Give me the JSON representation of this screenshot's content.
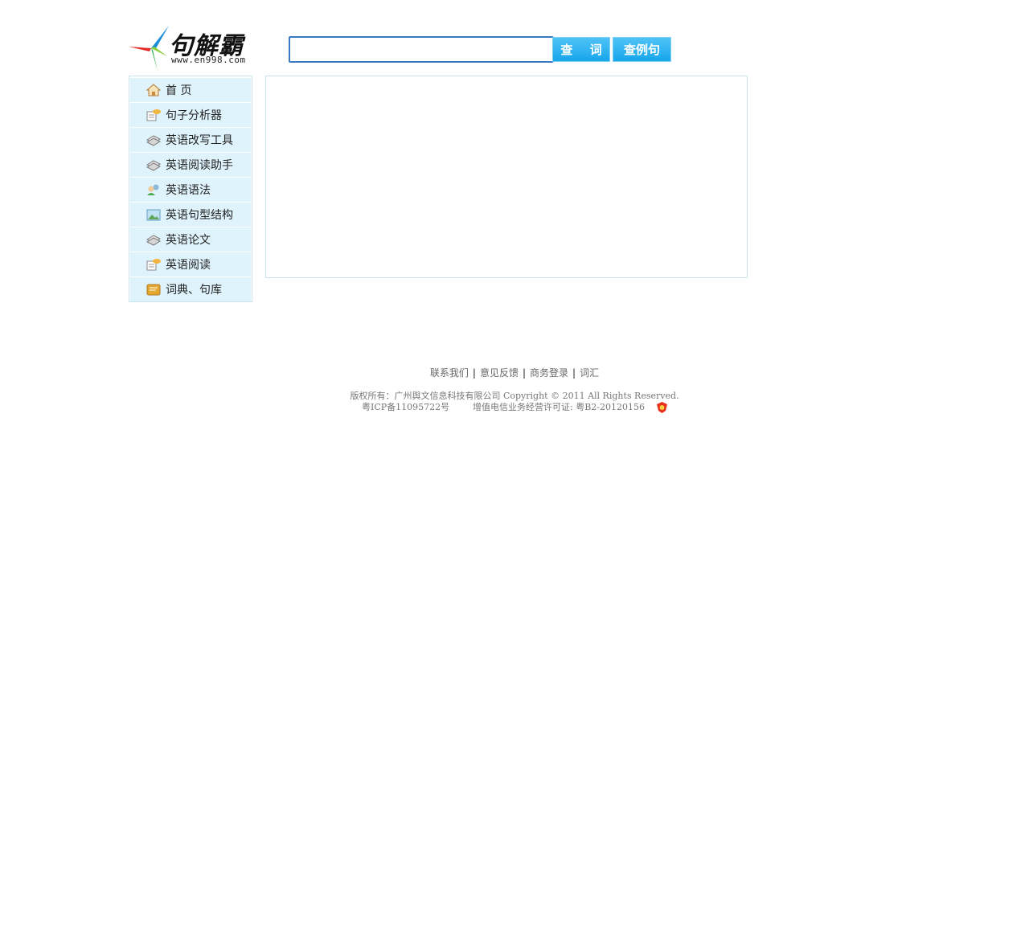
{
  "header": {
    "logo_title": "句解霸",
    "logo_url": "www.en998.com",
    "search_placeholder": "",
    "search_value": "",
    "btn_word": "查 词",
    "btn_sentence": "查例句"
  },
  "sidebar": {
    "items": [
      {
        "label": "首 页",
        "icon": "home-icon"
      },
      {
        "label": "句子分析器",
        "icon": "notepad-icon"
      },
      {
        "label": "英语改写工具",
        "icon": "books-icon"
      },
      {
        "label": "英语阅读助手",
        "icon": "books-icon"
      },
      {
        "label": "英语语法",
        "icon": "users-icon"
      },
      {
        "label": "英语句型结构",
        "icon": "image-icon"
      },
      {
        "label": "英语论文",
        "icon": "books-icon"
      },
      {
        "label": "英语阅读",
        "icon": "notepad-icon"
      },
      {
        "label": "词典、句库",
        "icon": "folder-icon"
      }
    ]
  },
  "footer": {
    "links": [
      "联系我们",
      "意见反馈",
      "商务登录",
      "词汇"
    ],
    "copyright": "版权所有：广州舆文信息科技有限公司 Copyright © 2011 All Rights Reserved.",
    "icp": "粤ICP备11095722号",
    "license": "增值电信业务经营许可证: 粤B2-20120156"
  },
  "colors": {
    "accent": "#1aa7ec",
    "nav_bg": "#dff3fc",
    "border": "#c8e4f2",
    "input_border": "#3a78c2"
  }
}
